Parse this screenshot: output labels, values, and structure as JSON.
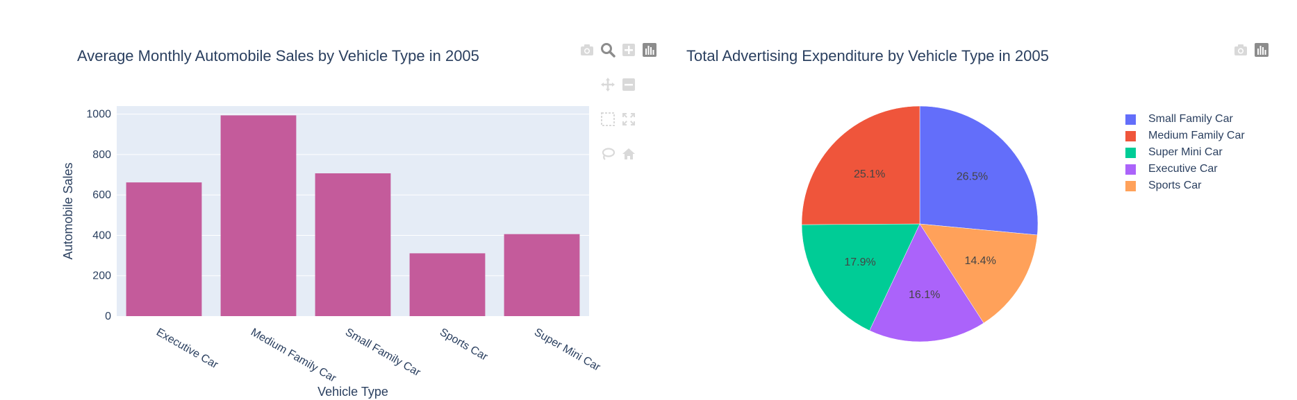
{
  "chart_data": [
    {
      "type": "bar",
      "title": "Average Monthly Automobile Sales by Vehicle Type in 2005",
      "xlabel": "Vehicle Type",
      "ylabel": "Automobile Sales",
      "categories": [
        "Executive Car",
        "Medium Family Car",
        "Small Family Car",
        "Sports Car",
        "Super Mini Car"
      ],
      "values": [
        662,
        994,
        707,
        311,
        406
      ],
      "ylim": [
        0,
        1040
      ],
      "yticks": [
        0,
        200,
        400,
        600,
        800,
        1000
      ],
      "color": "#c45b9b",
      "grid": true
    },
    {
      "type": "pie",
      "title": "Total Advertising Expenditure by Vehicle Type in 2005",
      "labels": [
        "Small Family Car",
        "Medium Family Car",
        "Super Mini Car",
        "Executive Car",
        "Sports Car"
      ],
      "values": [
        26.5,
        25.1,
        17.9,
        16.1,
        14.4
      ],
      "percent_labels": [
        "26.5%",
        "25.1%",
        "17.9%",
        "16.1%",
        "14.4%"
      ],
      "colors": [
        "#636efa",
        "#ef553b",
        "#00cc96",
        "#ab63fa",
        "#ffa15a"
      ],
      "legend_position": "top-right",
      "slice_order": [
        "Small Family Car",
        "Sports Car",
        "Executive Car",
        "Super Mini Car",
        "Medium Family Car"
      ]
    }
  ],
  "modebar": {
    "bar_icons": [
      "camera-icon",
      "zoom-icon",
      "zoom-in-icon",
      "plotly-logo-icon",
      "pan-icon",
      "zoom-out-icon",
      "box-select-icon",
      "autoscale-icon",
      "lasso-icon",
      "home-icon"
    ],
    "pie_icons": [
      "camera-icon",
      "plotly-logo-icon"
    ],
    "icon_color": "#d9d9d9",
    "active_color": "#8c8c8c"
  },
  "theme": {
    "plot_bg": "#e5ecf6",
    "grid_color": "#ffffff",
    "text_color": "#2a3f5f"
  }
}
